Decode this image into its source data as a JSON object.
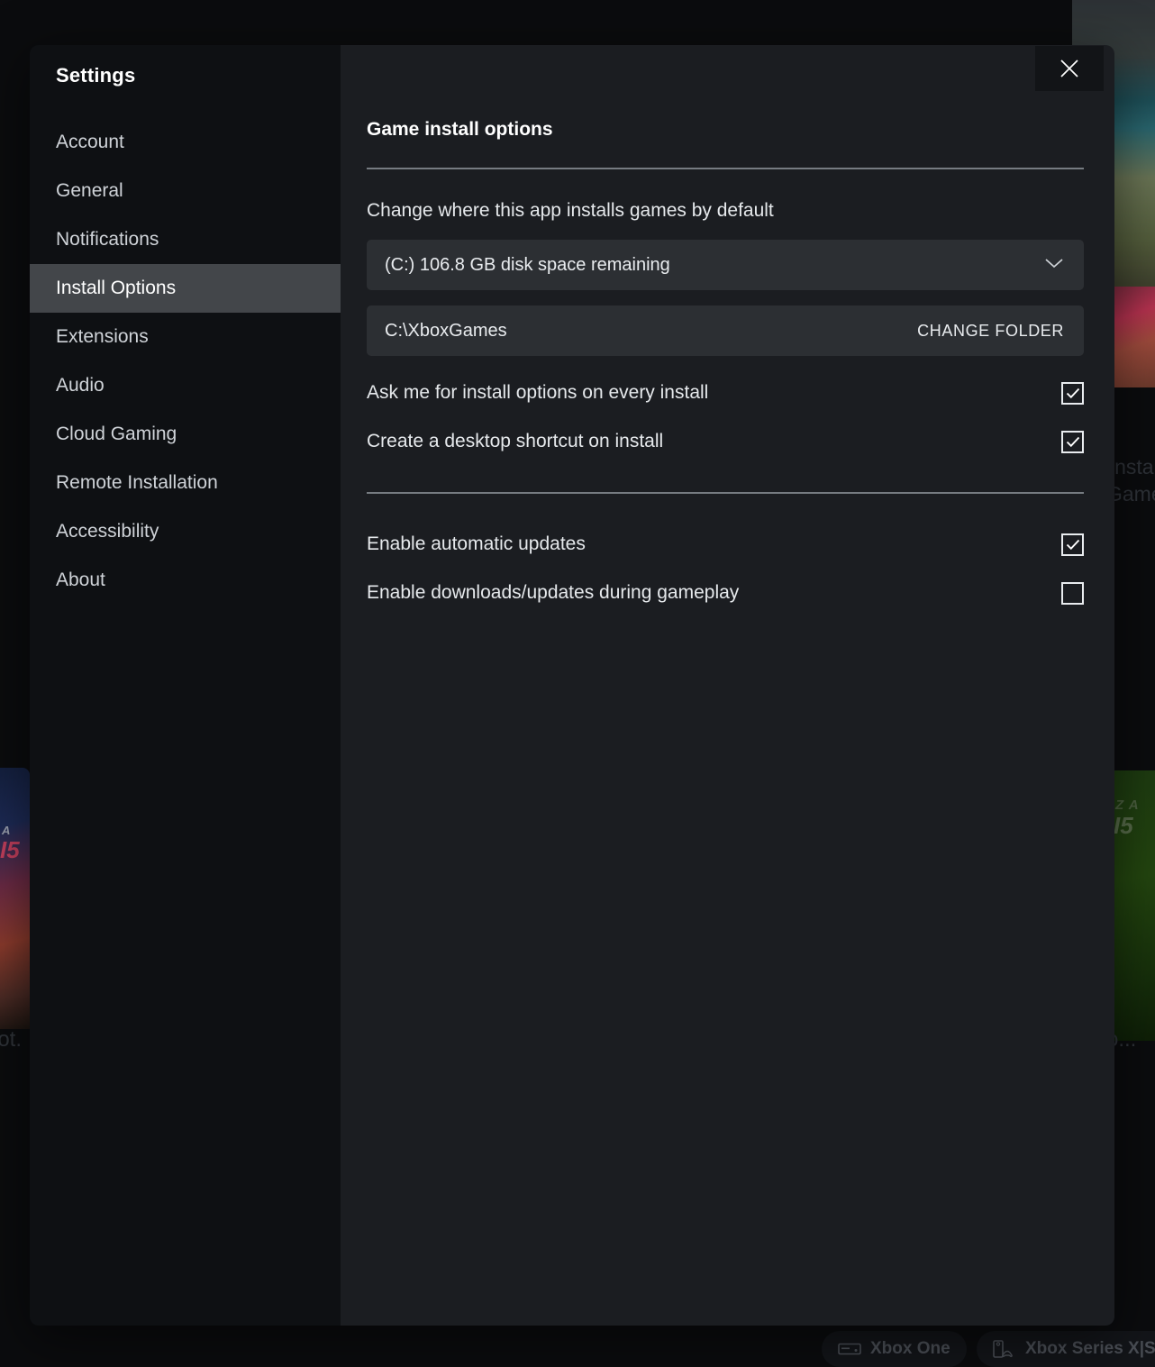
{
  "dialog": {
    "title": "Settings",
    "close_label": "Close",
    "close_icon": "close-icon"
  },
  "sidebar": {
    "items": [
      {
        "label": "Account",
        "selected": false
      },
      {
        "label": "General",
        "selected": false
      },
      {
        "label": "Notifications",
        "selected": false
      },
      {
        "label": "Install Options",
        "selected": true
      },
      {
        "label": "Extensions",
        "selected": false
      },
      {
        "label": "Audio",
        "selected": false
      },
      {
        "label": "Cloud Gaming",
        "selected": false
      },
      {
        "label": "Remote Installation",
        "selected": false
      },
      {
        "label": "Accessibility",
        "selected": false
      },
      {
        "label": "About",
        "selected": false
      }
    ]
  },
  "content": {
    "heading": "Game install options",
    "dropdown_label": "Change where this app installs games by default",
    "install_drive": {
      "value": "(C:) 106.8 GB disk space remaining",
      "chevron_icon": "chevron-down-icon"
    },
    "install_folder": {
      "path": "C:\\XboxGames",
      "change_button_label": "CHANGE FOLDER"
    },
    "options_group_1": [
      {
        "label": "Ask me for install options on every install",
        "checked": true
      },
      {
        "label": "Create a desktop shortcut on install",
        "checked": true
      }
    ],
    "options_group_2": [
      {
        "label": "Enable automatic updates",
        "checked": true
      },
      {
        "label": "Enable downloads/updates during gameplay",
        "checked": false
      }
    ]
  },
  "background": {
    "card_left_title": "A",
    "card_left_number": "I5",
    "card_right_title": "Z A",
    "card_right_number": "I5",
    "clipped_text_left": "lot.",
    "clipped_text_right": "o...",
    "clipped_text_insta": "insta",
    "clipped_text_game": "Game",
    "platforms": [
      {
        "label": "Xbox One",
        "icon": "xbox-one-console-icon"
      },
      {
        "label": "Xbox Series X|S",
        "icon": "xbox-series-console-icon"
      }
    ]
  },
  "colors": {
    "dialog_sidebar_bg": "#0e1013",
    "dialog_content_bg": "#1b1d21",
    "selected_nav_bg": "#43464a",
    "field_bg": "#2c2f33",
    "text_primary": "#ffffff",
    "text_secondary": "#e6e9ec",
    "divider": "#9aa0a6"
  }
}
